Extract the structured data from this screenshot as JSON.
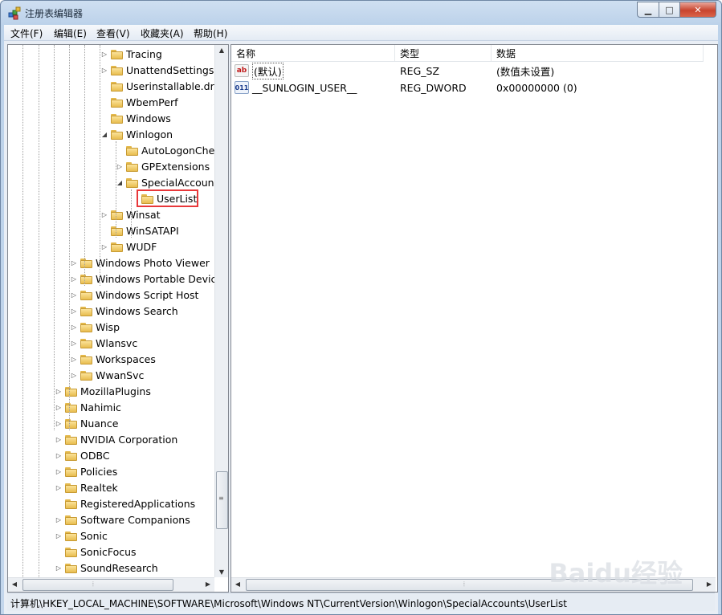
{
  "window": {
    "title": "注册表编辑器"
  },
  "menu": [
    "文件(F)",
    "编辑(E)",
    "查看(V)",
    "收藏夹(A)",
    "帮助(H)"
  ],
  "tree": [
    {
      "label": "Tracing",
      "level": 3,
      "expander": "▷"
    },
    {
      "label": "UnattendSettings",
      "level": 3,
      "expander": "▷"
    },
    {
      "label": "Userinstallable.driv",
      "level": 3,
      "expander": ""
    },
    {
      "label": "WbemPerf",
      "level": 3,
      "expander": ""
    },
    {
      "label": "Windows",
      "level": 3,
      "expander": ""
    },
    {
      "label": "Winlogon",
      "level": 3,
      "expander": "◢"
    },
    {
      "label": "AutoLogonChe",
      "level": 4,
      "expander": ""
    },
    {
      "label": "GPExtensions",
      "level": 4,
      "expander": "▷"
    },
    {
      "label": "SpecialAccount",
      "level": 4,
      "expander": "◢"
    },
    {
      "label": "UserList",
      "level": 5,
      "expander": "",
      "selected": true
    },
    {
      "label": "Winsat",
      "level": 3,
      "expander": "▷"
    },
    {
      "label": "WinSATAPI",
      "level": 3,
      "expander": ""
    },
    {
      "label": "WUDF",
      "level": 3,
      "expander": "▷"
    },
    {
      "label": "Windows Photo Viewer",
      "level": 2,
      "expander": "▷"
    },
    {
      "label": "Windows Portable Device",
      "level": 2,
      "expander": "▷"
    },
    {
      "label": "Windows Script Host",
      "level": 2,
      "expander": "▷"
    },
    {
      "label": "Windows Search",
      "level": 2,
      "expander": "▷"
    },
    {
      "label": "Wisp",
      "level": 2,
      "expander": "▷"
    },
    {
      "label": "Wlansvc",
      "level": 2,
      "expander": "▷"
    },
    {
      "label": "Workspaces",
      "level": 2,
      "expander": "▷"
    },
    {
      "label": "WwanSvc",
      "level": 2,
      "expander": "▷"
    },
    {
      "label": "MozillaPlugins",
      "level": 1,
      "expander": "▷"
    },
    {
      "label": "Nahimic",
      "level": 1,
      "expander": "▷"
    },
    {
      "label": "Nuance",
      "level": 1,
      "expander": "▷"
    },
    {
      "label": "NVIDIA Corporation",
      "level": 1,
      "expander": "▷"
    },
    {
      "label": "ODBC",
      "level": 1,
      "expander": "▷"
    },
    {
      "label": "Policies",
      "level": 1,
      "expander": "▷"
    },
    {
      "label": "Realtek",
      "level": 1,
      "expander": "▷"
    },
    {
      "label": "RegisteredApplications",
      "level": 1,
      "expander": ""
    },
    {
      "label": "Software Companions",
      "level": 1,
      "expander": "▷"
    },
    {
      "label": "Sonic",
      "level": 1,
      "expander": "▷"
    },
    {
      "label": "SonicFocus",
      "level": 1,
      "expander": ""
    },
    {
      "label": "SoundResearch",
      "level": 1,
      "expander": "▷"
    }
  ],
  "columns": [
    "名称",
    "类型",
    "数据"
  ],
  "values": [
    {
      "name": "(默认)",
      "type": "REG_SZ",
      "data": "(数值未设置)",
      "icon": "string-value-icon"
    },
    {
      "name": "__SUNLOGIN_USER__",
      "type": "REG_DWORD",
      "data": "0x00000000 (0)",
      "icon": "dword-value-icon"
    }
  ],
  "status": "计算机\\HKEY_LOCAL_MACHINE\\SOFTWARE\\Microsoft\\Windows NT\\CurrentVersion\\Winlogon\\SpecialAccounts\\UserList",
  "watermark": "Baidu经验",
  "scroll": {
    "tree_vertical_position": 0.92
  }
}
